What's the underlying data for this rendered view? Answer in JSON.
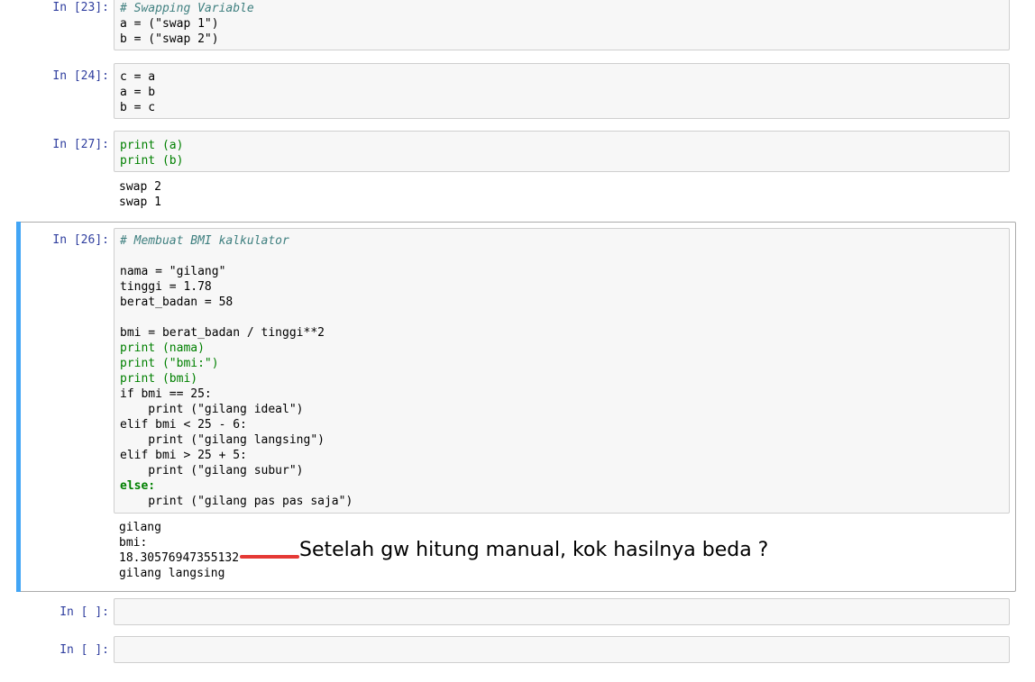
{
  "cells": [
    {
      "prompt": "In [23]:",
      "code_lines": [
        "# Swapping Variable",
        "a = (\"swap 1\")",
        "b = (\"swap 2\")"
      ]
    },
    {
      "prompt": "In [24]:",
      "code_lines": [
        "c = a",
        "a = b",
        "b = c"
      ]
    },
    {
      "prompt": "In [27]:",
      "code_lines": [
        "print (a)",
        "print (b)"
      ],
      "output_lines": [
        "swap 2",
        "swap 1"
      ]
    },
    {
      "prompt": "In [26]:",
      "code_lines": [
        "# Membuat BMI kalkulator",
        "",
        "nama = \"gilang\"",
        "tinggi = 1.78",
        "berat_badan = 58",
        "",
        "bmi = berat_badan / tinggi**2",
        "print (nama)",
        "print (\"bmi:\")",
        "print (bmi)",
        "if bmi == 25:",
        "    print (\"gilang ideal\")",
        "elif bmi < 25 - 6:",
        "    print (\"gilang langsing\")",
        "elif bmi > 25 + 5:",
        "    print (\"gilang subur\")",
        "else:",
        "    print (\"gilang pas pas saja\")"
      ],
      "output_lines": [
        "gilang",
        "bmi:",
        "18.30576947355132",
        "gilang langsing"
      ]
    },
    {
      "prompt": "In [ ]:",
      "code_lines": []
    },
    {
      "prompt": "In [ ]:",
      "code_lines": []
    }
  ],
  "annotation": {
    "text": "Setelah gw hitung manual, kok hasilnya beda ?",
    "color": "#e53935"
  },
  "colors": {
    "prompt": "#303f9f",
    "selected_bar": "#42a5f5",
    "cell_bg": "#f7f7f7"
  }
}
